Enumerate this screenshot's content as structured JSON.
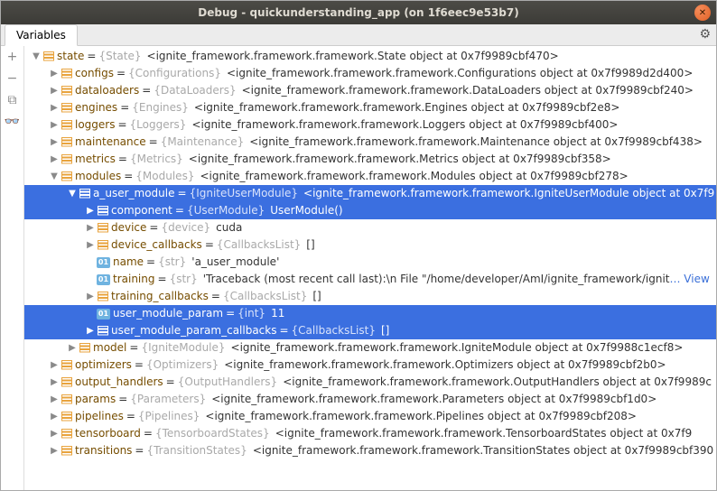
{
  "window": {
    "title": "Debug - quickunderstanding_app (on 1f6eec9e53b7)"
  },
  "tabs": {
    "variables": "Variables"
  },
  "gutter": {
    "add": "+",
    "remove": "−",
    "copy": "⧉",
    "glasses": "👓"
  },
  "tree": [
    {
      "depth": 0,
      "arrow": "down",
      "icon": "obj",
      "name": "state",
      "type": "{State}",
      "val": "<ignite_framework.framework.framework.State object at 0x7f9989cbf470>"
    },
    {
      "depth": 1,
      "arrow": "right",
      "icon": "obj",
      "name": "configs",
      "type": "{Configurations}",
      "val": "<ignite_framework.framework.framework.Configurations object at 0x7f9989d2d400>"
    },
    {
      "depth": 1,
      "arrow": "right",
      "icon": "obj",
      "name": "dataloaders",
      "type": "{DataLoaders}",
      "val": "<ignite_framework.framework.framework.DataLoaders object at 0x7f9989cbf240>"
    },
    {
      "depth": 1,
      "arrow": "right",
      "icon": "obj",
      "name": "engines",
      "type": "{Engines}",
      "val": "<ignite_framework.framework.framework.Engines object at 0x7f9989cbf2e8>"
    },
    {
      "depth": 1,
      "arrow": "right",
      "icon": "obj",
      "name": "loggers",
      "type": "{Loggers}",
      "val": "<ignite_framework.framework.framework.Loggers object at 0x7f9989cbf400>"
    },
    {
      "depth": 1,
      "arrow": "right",
      "icon": "obj",
      "name": "maintenance",
      "type": "{Maintenance}",
      "val": "<ignite_framework.framework.framework.Maintenance object at 0x7f9989cbf438>"
    },
    {
      "depth": 1,
      "arrow": "right",
      "icon": "obj",
      "name": "metrics",
      "type": "{Metrics}",
      "val": "<ignite_framework.framework.framework.Metrics object at 0x7f9989cbf358>"
    },
    {
      "depth": 1,
      "arrow": "down",
      "icon": "obj",
      "name": "modules",
      "type": "{Modules}",
      "val": "<ignite_framework.framework.framework.Modules object at 0x7f9989cbf278>"
    },
    {
      "depth": 2,
      "arrow": "down",
      "icon": "obj",
      "sel": true,
      "name": "a_user_module",
      "type": "{IgniteUserModule}",
      "val": "<ignite_framework.framework.framework.IgniteUserModule object at 0x7f9"
    },
    {
      "depth": 3,
      "arrow": "right",
      "icon": "obj",
      "sel": true,
      "name": "component",
      "type": "{UserModule}",
      "val": "UserModule()"
    },
    {
      "depth": 3,
      "arrow": "right",
      "icon": "obj",
      "name": "device",
      "type": "{device}",
      "val": "cuda"
    },
    {
      "depth": 3,
      "arrow": "right",
      "icon": "obj",
      "name": "device_callbacks",
      "type": "{CallbacksList}",
      "val": "[]"
    },
    {
      "depth": 3,
      "arrow": "",
      "icon": "str",
      "name": "name",
      "type": "{str}",
      "val": "'a_user_module'"
    },
    {
      "depth": 3,
      "arrow": "",
      "icon": "str",
      "name": "training",
      "type": "{str}",
      "val": "'Traceback (most recent call last):\\n  File \"/home/developer/AmI/ignite_framework/ignit",
      "link": "… View"
    },
    {
      "depth": 3,
      "arrow": "right",
      "icon": "obj",
      "name": "training_callbacks",
      "type": "{CallbacksList}",
      "val": "[]"
    },
    {
      "depth": 3,
      "arrow": "",
      "icon": "str",
      "sel": true,
      "name": "user_module_param",
      "type": "{int}",
      "val": "11"
    },
    {
      "depth": 3,
      "arrow": "right",
      "icon": "obj",
      "sel": true,
      "name": "user_module_param_callbacks",
      "type": "{CallbacksList}",
      "val": "[]"
    },
    {
      "depth": 2,
      "arrow": "right",
      "icon": "obj",
      "name": "model",
      "type": "{IgniteModule}",
      "val": "<ignite_framework.framework.framework.IgniteModule object at 0x7f9988c1ecf8>"
    },
    {
      "depth": 1,
      "arrow": "right",
      "icon": "obj",
      "name": "optimizers",
      "type": "{Optimizers}",
      "val": "<ignite_framework.framework.framework.Optimizers object at 0x7f9989cbf2b0>"
    },
    {
      "depth": 1,
      "arrow": "right",
      "icon": "obj",
      "name": "output_handlers",
      "type": "{OutputHandlers}",
      "val": "<ignite_framework.framework.framework.OutputHandlers object at 0x7f9989c"
    },
    {
      "depth": 1,
      "arrow": "right",
      "icon": "obj",
      "name": "params",
      "type": "{Parameters}",
      "val": "<ignite_framework.framework.framework.Parameters object at 0x7f9989cbf1d0>"
    },
    {
      "depth": 1,
      "arrow": "right",
      "icon": "obj",
      "name": "pipelines",
      "type": "{Pipelines}",
      "val": "<ignite_framework.framework.framework.Pipelines object at 0x7f9989cbf208>"
    },
    {
      "depth": 1,
      "arrow": "right",
      "icon": "obj",
      "name": "tensorboard",
      "type": "{TensorboardStates}",
      "val": "<ignite_framework.framework.framework.TensorboardStates object at 0x7f9"
    },
    {
      "depth": 1,
      "arrow": "right",
      "icon": "obj",
      "name": "transitions",
      "type": "{TransitionStates}",
      "val": "<ignite_framework.framework.framework.TransitionStates object at 0x7f9989cbf390"
    }
  ]
}
